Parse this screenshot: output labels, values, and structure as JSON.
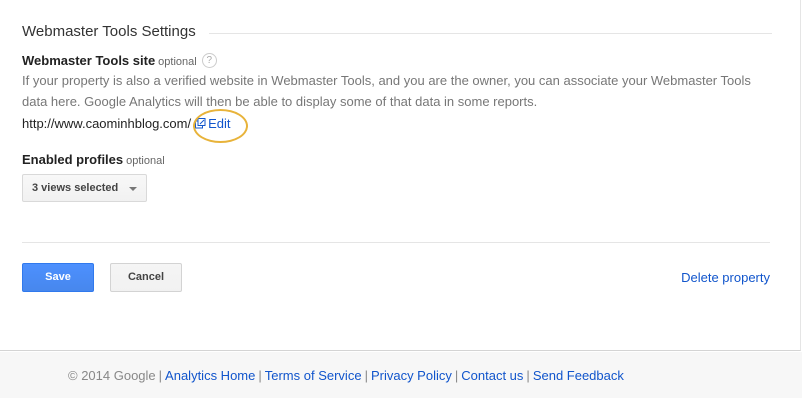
{
  "section": {
    "title": "Webmaster Tools Settings"
  },
  "webmaster_site": {
    "label": "Webmaster Tools site",
    "optional": "optional",
    "help_icon": "?",
    "description": "If your property is also a verified website in Webmaster Tools, and you are the owner, you can associate your Webmaster Tools data here. Google Analytics will then be able to display some of that data in some reports.",
    "url": "http://www.caominhblog.com/",
    "edit_label": "Edit",
    "external_icon": "external-link-icon"
  },
  "profiles": {
    "label": "Enabled profiles",
    "optional": "optional",
    "selected": "3 views selected"
  },
  "actions": {
    "save": "Save",
    "cancel": "Cancel",
    "delete": "Delete property"
  },
  "footer": {
    "copyright": "© 2014 Google",
    "links": [
      "Analytics Home",
      "Terms of Service",
      "Privacy Policy",
      "Contact us",
      "Send Feedback"
    ]
  },
  "colors": {
    "primary_button": "#4d90fe",
    "link": "#1155cc",
    "highlight_ring": "#e8b33a"
  }
}
